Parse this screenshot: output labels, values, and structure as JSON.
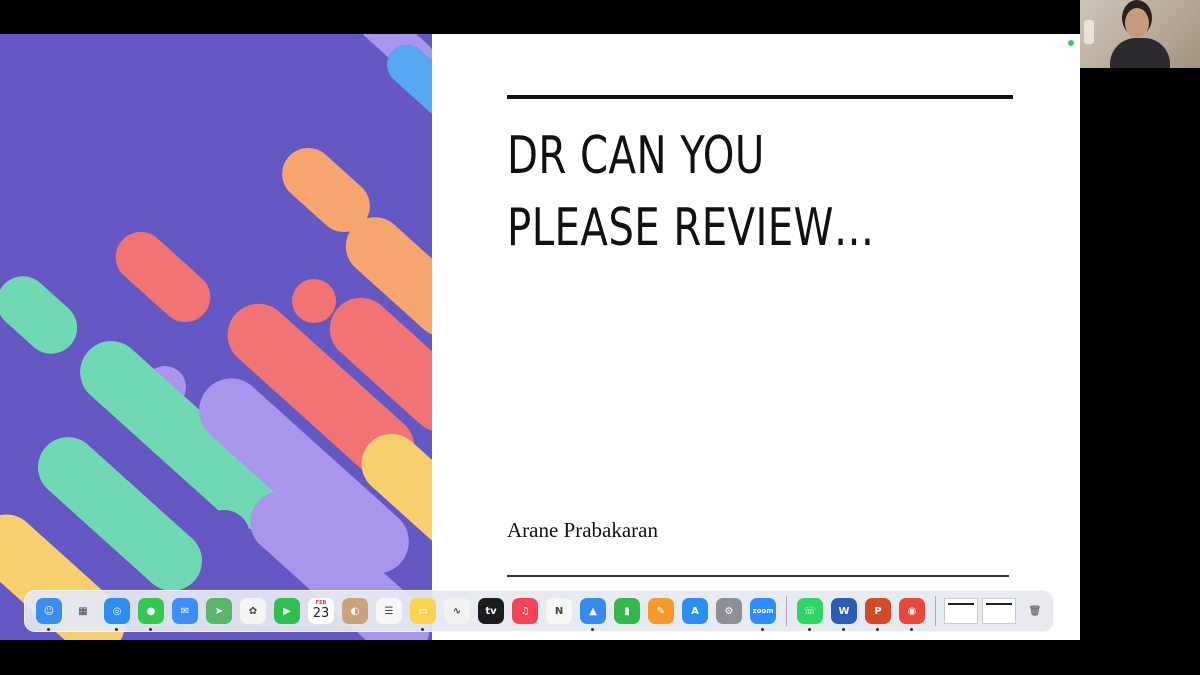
{
  "slide": {
    "title_line1": "DR CAN YOU",
    "title_line2": "PLEASE REVIEW…",
    "author": "Arane Prabakaran"
  },
  "colors": {
    "art_background": "#6558c4",
    "coral": "#f17373",
    "peach": "#f7a56f",
    "mint": "#6fd8b2",
    "lavender": "#a995ec",
    "yellow": "#f8cf6f",
    "blue": "#56a6f0"
  },
  "dock": {
    "apps": [
      {
        "name": "finder-icon",
        "glyph": "☺",
        "color": "#3a8ef0",
        "running": true
      },
      {
        "name": "launchpad-icon",
        "glyph": "▦",
        "color": "#e6e6ee",
        "running": false
      },
      {
        "name": "safari-icon",
        "glyph": "◎",
        "color": "#2f8cf0",
        "running": true
      },
      {
        "name": "messages-icon",
        "glyph": "●",
        "color": "#36c750",
        "running": true
      },
      {
        "name": "mail-icon",
        "glyph": "✉",
        "color": "#3d8ff5",
        "running": false
      },
      {
        "name": "maps-icon",
        "glyph": "➤",
        "color": "#58b56c",
        "running": false
      },
      {
        "name": "photos-icon",
        "glyph": "✿",
        "color": "#f4f4f4",
        "running": false
      },
      {
        "name": "facetime-icon",
        "glyph": "▶",
        "color": "#2fbf4f",
        "running": false
      },
      {
        "name": "calendar-icon",
        "glyph": "",
        "color": "#ffffff",
        "running": false
      },
      {
        "name": "contacts-icon",
        "glyph": "◐",
        "color": "#c9a37b",
        "running": false
      },
      {
        "name": "reminders-icon",
        "glyph": "☰",
        "color": "#f6f6f6",
        "running": false
      },
      {
        "name": "notes-icon",
        "glyph": "▭",
        "color": "#f8d34f",
        "running": true
      },
      {
        "name": "freeform-icon",
        "glyph": "∿",
        "color": "#f2f2f2",
        "running": false
      },
      {
        "name": "apple-tv-icon",
        "glyph": "tv",
        "color": "#1c1c1e",
        "running": false
      },
      {
        "name": "music-icon",
        "glyph": "♫",
        "color": "#f5435a",
        "running": false
      },
      {
        "name": "news-icon",
        "glyph": "N",
        "color": "#f6f6f6",
        "running": false
      },
      {
        "name": "keynote-icon",
        "glyph": "▲",
        "color": "#3889f0",
        "running": true
      },
      {
        "name": "numbers-icon",
        "glyph": "▮",
        "color": "#33b84e",
        "running": false
      },
      {
        "name": "pages-icon",
        "glyph": "✎",
        "color": "#f69a2a",
        "running": false
      },
      {
        "name": "app-store-icon",
        "glyph": "A",
        "color": "#2b8ef2",
        "running": false
      },
      {
        "name": "system-settings-icon",
        "glyph": "⚙",
        "color": "#8d8f96",
        "running": false
      },
      {
        "name": "zoom-icon",
        "glyph": "zoom",
        "color": "#2d8cff",
        "running": true
      }
    ],
    "pinned": [
      {
        "name": "whatsapp-icon",
        "glyph": "☏",
        "color": "#2fd366",
        "running": true
      },
      {
        "name": "word-icon",
        "glyph": "W",
        "color": "#2b5cb8",
        "running": true
      },
      {
        "name": "powerpoint-icon",
        "glyph": "P",
        "color": "#d04b26",
        "running": true
      },
      {
        "name": "chrome-icon",
        "glyph": "◉",
        "color": "#e9463c",
        "running": true
      }
    ],
    "calendar": {
      "month": "FEB",
      "day": "23"
    }
  }
}
